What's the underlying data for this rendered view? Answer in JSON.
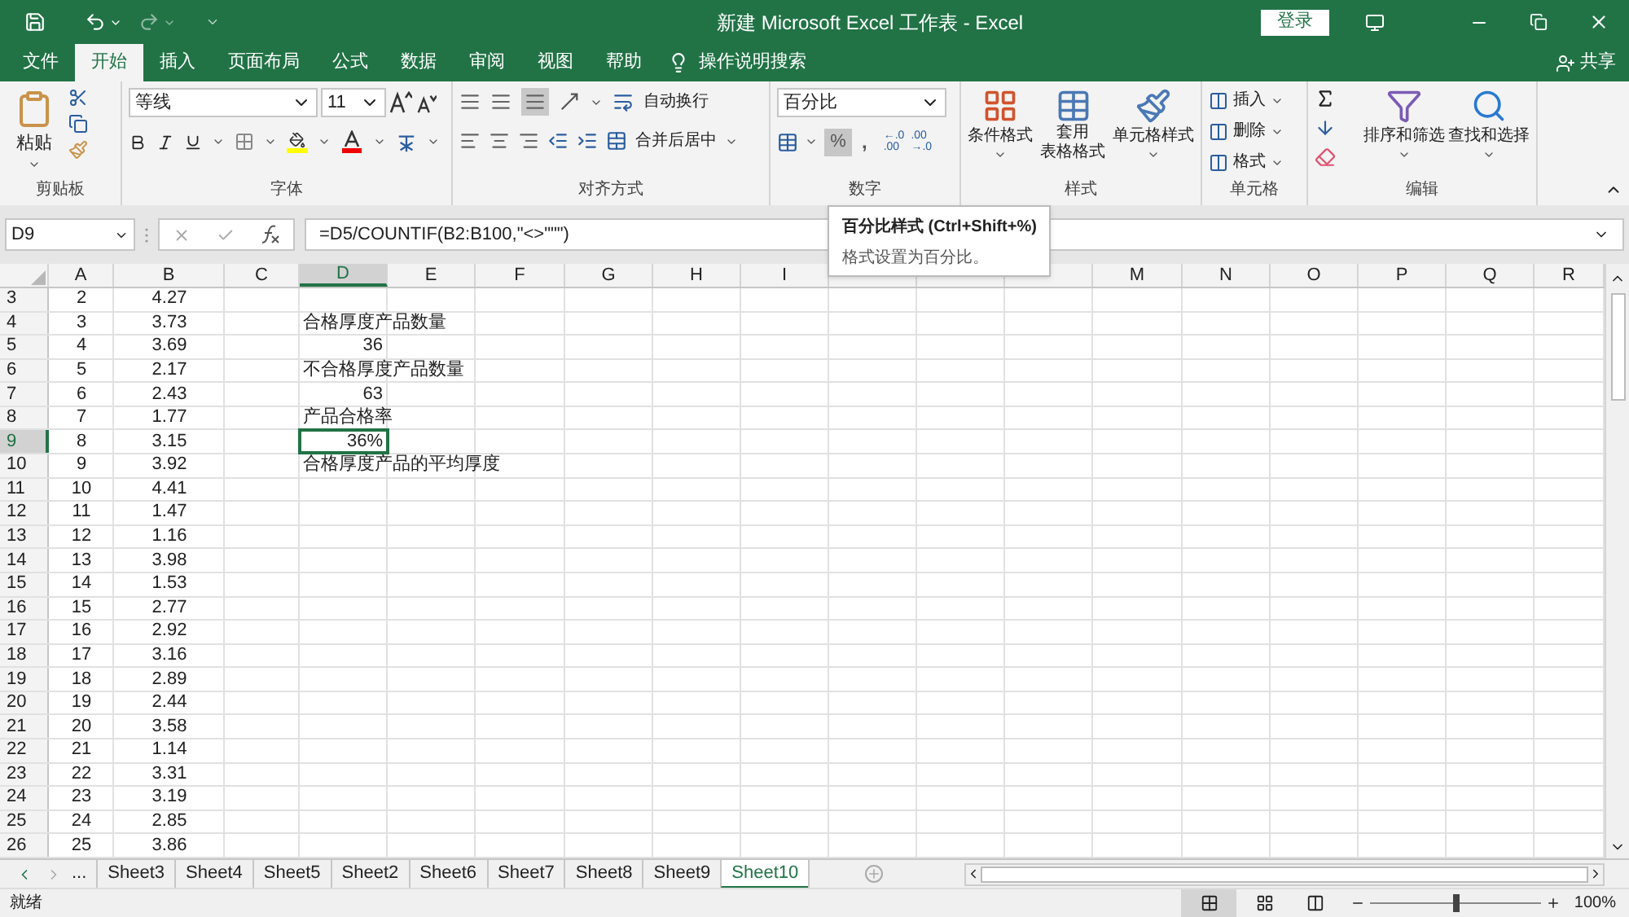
{
  "title_bar": {
    "title": "新建 Microsoft Excel 工作表  -  Excel",
    "login": "登录"
  },
  "menu_tabs": [
    {
      "label": "文件",
      "selected": false
    },
    {
      "label": "开始",
      "selected": true
    },
    {
      "label": "插入",
      "selected": false
    },
    {
      "label": "页面布局",
      "selected": false
    },
    {
      "label": "公式",
      "selected": false
    },
    {
      "label": "数据",
      "selected": false
    },
    {
      "label": "审阅",
      "selected": false
    },
    {
      "label": "视图",
      "selected": false
    },
    {
      "label": "帮助",
      "selected": false
    }
  ],
  "tell_me": "操作说明搜索",
  "share": "共享",
  "ribbon": {
    "clipboard": {
      "paste": "粘贴",
      "group": "剪贴板"
    },
    "font": {
      "name": "等线",
      "size": "11",
      "group": "字体"
    },
    "alignment": {
      "wrap": "自动换行",
      "merge": "合并后居中",
      "group": "对齐方式"
    },
    "number": {
      "format": "百分比",
      "percent": "%",
      "percent_pressed": true,
      "comma": ",",
      "increase_decimal": [
        "←.0",
        ".00"
      ],
      "decrease_decimal": [
        ".00",
        "→.0"
      ],
      "group": "数字"
    },
    "styles": {
      "conditional": "条件格式",
      "table_1": "套用",
      "table_2": "表格格式",
      "cell_styles": "单元格样式",
      "group": "样式"
    },
    "cells": {
      "insert": "插入",
      "delete": "删除",
      "format": "格式",
      "group": "单元格"
    },
    "editing": {
      "sort": "排序和筛选",
      "find": "查找和选择",
      "group": "编辑"
    }
  },
  "tooltip": {
    "title": "百分比样式 (Ctrl+Shift+%)",
    "text": "格式设置为百分比。"
  },
  "formula_bar": {
    "name_box": "D9",
    "formula": "=D5/COUNTIF(B2:B100,\"<>\"\"\")"
  },
  "columns_before_tooltip": [
    "A",
    "B",
    "C",
    "D",
    "E",
    "F",
    "G",
    "H",
    "I"
  ],
  "columns_after_tooltip": [
    "M",
    "N",
    "O",
    "P",
    "Q",
    "R"
  ],
  "rows": [
    {
      "row": "3",
      "a": "2",
      "b": "4.27"
    },
    {
      "row": "4",
      "a": "3",
      "b": "3.73",
      "d": {
        "text": "合格厚度产品数量",
        "kind": "text",
        "selected": false
      }
    },
    {
      "row": "5",
      "a": "4",
      "b": "3.69",
      "d": {
        "text": "36",
        "kind": "number",
        "selected": false
      }
    },
    {
      "row": "6",
      "a": "5",
      "b": "2.17",
      "d": {
        "text": "不合格厚度产品数量",
        "kind": "text",
        "selected": false
      }
    },
    {
      "row": "7",
      "a": "6",
      "b": "2.43",
      "d": {
        "text": "63",
        "kind": "number",
        "selected": false
      }
    },
    {
      "row": "8",
      "a": "7",
      "b": "1.77",
      "d": {
        "text": "产品合格率",
        "kind": "text",
        "selected": false
      }
    },
    {
      "row": "9",
      "a": "8",
      "b": "3.15",
      "d": {
        "text": "36%",
        "kind": "number",
        "selected": true
      }
    },
    {
      "row": "10",
      "a": "9",
      "b": "3.92",
      "d": {
        "text": "合格厚度产品的平均厚度",
        "kind": "text",
        "selected": false
      }
    },
    {
      "row": "11",
      "a": "10",
      "b": "4.41"
    },
    {
      "row": "12",
      "a": "11",
      "b": "1.47"
    },
    {
      "row": "13",
      "a": "12",
      "b": "1.16"
    },
    {
      "row": "14",
      "a": "13",
      "b": "3.98"
    },
    {
      "row": "15",
      "a": "14",
      "b": "1.53"
    },
    {
      "row": "16",
      "a": "15",
      "b": "2.77"
    },
    {
      "row": "17",
      "a": "16",
      "b": "2.92"
    },
    {
      "row": "18",
      "a": "17",
      "b": "3.16"
    },
    {
      "row": "19",
      "a": "18",
      "b": "2.89"
    },
    {
      "row": "20",
      "a": "19",
      "b": "2.44"
    },
    {
      "row": "21",
      "a": "20",
      "b": "3.58"
    },
    {
      "row": "22",
      "a": "21",
      "b": "1.14"
    },
    {
      "row": "23",
      "a": "22",
      "b": "3.31"
    },
    {
      "row": "24",
      "a": "23",
      "b": "3.19"
    },
    {
      "row": "25",
      "a": "24",
      "b": "2.85"
    },
    {
      "row": "26",
      "a": "25",
      "b": "3.86"
    }
  ],
  "sheet_tabs": {
    "more": "...",
    "tabs": [
      {
        "label": "Sheet3",
        "selected": false
      },
      {
        "label": "Sheet4",
        "selected": false
      },
      {
        "label": "Sheet5",
        "selected": false
      },
      {
        "label": "Sheet2",
        "selected": false
      },
      {
        "label": "Sheet6",
        "selected": false
      },
      {
        "label": "Sheet7",
        "selected": false
      },
      {
        "label": "Sheet8",
        "selected": false
      },
      {
        "label": "Sheet9",
        "selected": false
      },
      {
        "label": "Sheet10",
        "selected": true
      }
    ]
  },
  "status_bar": {
    "status": "就绪",
    "zoom": "100%",
    "zoom_slider": {
      "level": 0.5
    }
  }
}
